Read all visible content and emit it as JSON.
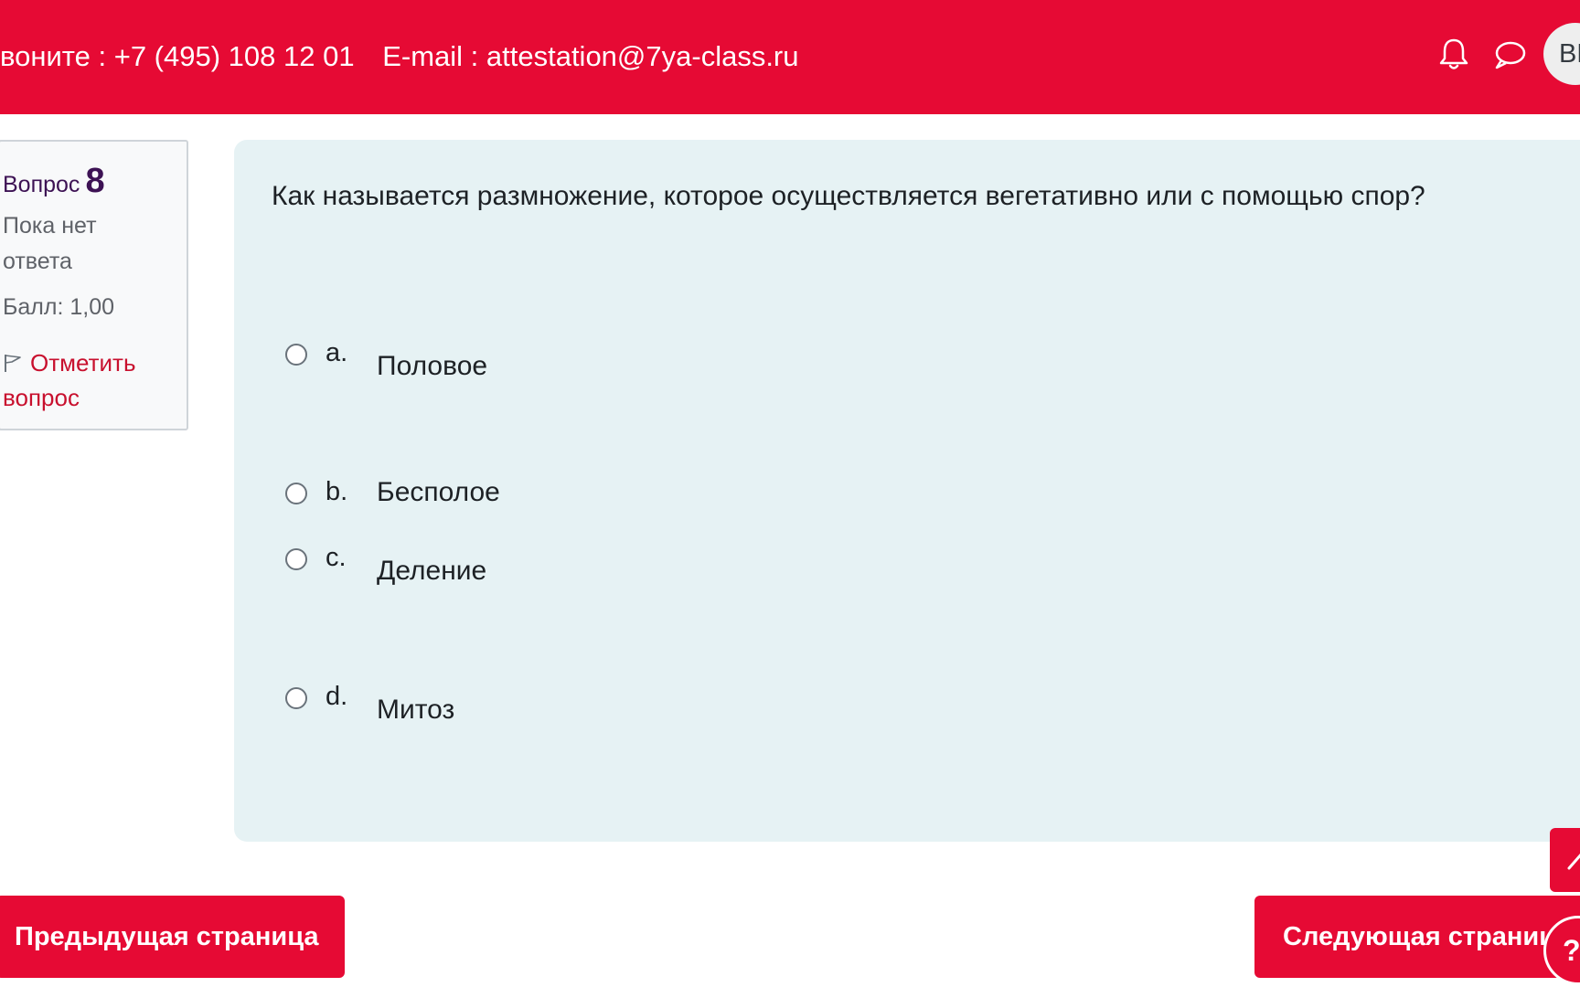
{
  "header": {
    "phone_text": "воните : +7 (495) 108 12 01",
    "email_text": "E-mail : attestation@7ya-class.ru",
    "avatar_initials": "ВЕ",
    "accent_color": "#e60a34"
  },
  "question_info": {
    "label": "Вопрос",
    "number": "8",
    "state": "Пока нет ответа",
    "grade": "Балл: 1,00",
    "flag_label": "Отметить вопрос"
  },
  "question": {
    "text": "Как называется размножение, которое осуществляется вегетативно или с помощью спор?",
    "options": [
      {
        "letter": "a.",
        "text": "Половое",
        "selected": false
      },
      {
        "letter": "b.",
        "text": "Бесполое",
        "selected": false
      },
      {
        "letter": "c.",
        "text": "Деление",
        "selected": false
      },
      {
        "letter": "d.",
        "text": "Митоз",
        "selected": false
      }
    ]
  },
  "navigation": {
    "prev_label": "Предыдущая страница",
    "next_label": "Следующая страница"
  },
  "help": {
    "label": "?"
  },
  "icons": [
    "bell-icon",
    "chat-icon",
    "flag-icon",
    "chevron-up-icon",
    "help-icon"
  ]
}
